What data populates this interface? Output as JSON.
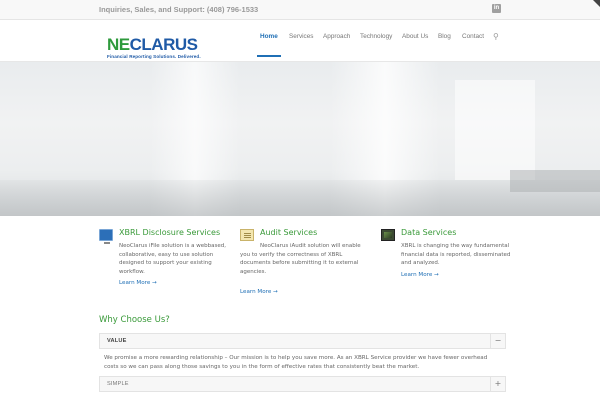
{
  "topbar": {
    "phone": "Inquiries, Sales, and Support: (408) 796-1533",
    "social_icon": "linkedin-icon",
    "social_glyph": "in"
  },
  "logo": {
    "neo": "NE",
    "c": "C",
    "larus": "LARUS",
    "tagline": "Financial Reporting Solutions. Delivered.",
    "colors": {
      "green": "#2e9a3c",
      "blue": "#1f5aa6"
    }
  },
  "nav": {
    "items": [
      "Home",
      "Services",
      "Approach",
      "Technology",
      "About Us",
      "Blog",
      "Contact"
    ],
    "active": "Home",
    "search_icon": "search-icon",
    "accent": "#1f6fb5"
  },
  "services": [
    {
      "icon": "monitor-icon",
      "title": "XBRL Disclosure Services",
      "text": "NeoClarus iFile solution is a webbased, collaborative, easy to use solution designed to support your existing workflow.",
      "link": "Learn More →"
    },
    {
      "icon": "notepad-icon",
      "title": "Audit Services",
      "text": "NeoClarus iAudit solution will enable you to verify the correctness of XBRL documents before submitting it to external agencies.",
      "link": "Learn More →"
    },
    {
      "icon": "data-screen-icon",
      "title": "Data Services",
      "text": "XBRL is changing the way fundamental financial data is reported, disseminated and analyzed.",
      "link": "Learn More →"
    }
  ],
  "why": {
    "title": "Why Choose Us?",
    "accordion": [
      {
        "label": "VALUE",
        "open": true,
        "toggle": "−",
        "body": "We promise a more rewarding relationship – Our mission is to help you save more. As an XBRL Service provider we have fewer overhead costs so we can pass along those savings to you in the form of effective rates that consistently beat the market."
      },
      {
        "label": "SIMPLE",
        "open": false,
        "toggle": "+"
      }
    ]
  },
  "colors": {
    "heading_green": "#3a9a3a",
    "link_blue": "#1f6fb5",
    "text_gray": "#666666"
  }
}
